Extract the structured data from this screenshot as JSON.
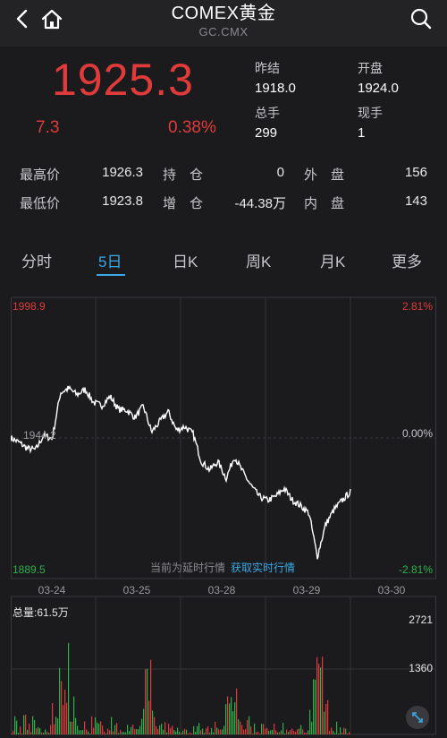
{
  "nav": {
    "title": "COMEX黄金",
    "subtitle": "GC.CMX"
  },
  "quote": {
    "price": "1925.3",
    "change": "7.3",
    "change_pct": "0.38%",
    "prev_close_label": "昨结",
    "prev_close": "1918.0",
    "open_label": "开盘",
    "open": "1924.0",
    "volume_label": "总手",
    "volume": "299",
    "current_volume_label": "现手",
    "current_volume": "1"
  },
  "stats": {
    "high_label": "最高价",
    "high": "1926.3",
    "low_label": "最低价",
    "low": "1923.8",
    "oi_label": "持　仓",
    "oi": "0",
    "oi_change_label": "增　仓",
    "oi_change": "-44.38万",
    "outer_label": "外　盘",
    "outer": "156",
    "inner_label": "内　盘",
    "inner": "143"
  },
  "tabs": [
    "分时",
    "5日",
    "日K",
    "周K",
    "月K",
    "更多"
  ],
  "active_tab": 1,
  "colors": {
    "up": "#e03b3b",
    "down": "#2fb14a",
    "accent": "#3aa8e6",
    "line": "#ffffff"
  },
  "chart_labels": {
    "max_price": "1998.9",
    "min_price": "1889.5",
    "max_pct": "2.81%",
    "zero_pct": "0.00%",
    "min_pct": "-2.81%",
    "notice": "当前为延时行情",
    "realtime_link": "获取实时行情",
    "volume_label": "总量:61.5万",
    "vol_max": "2721",
    "vol_mid": "1360",
    "center_price": "1944.2"
  },
  "chart_data": {
    "type": "line",
    "x": [
      "03-24",
      "03-25",
      "03-28",
      "03-29",
      "03-30"
    ],
    "ylim": [
      1889.5,
      1998.9
    ],
    "series": [
      {
        "values": [
          1944.2,
          1942.5,
          1940.1,
          1939.6,
          1945.3,
          1943.8,
          1961.8,
          1963.5,
          1961.0,
          1963.1,
          1958.0,
          1956.8,
          1960.4,
          1955.3,
          1955.0,
          1952.2,
          1956.6,
          1946.5,
          1950.6,
          1954.5,
          1947.2,
          1948.6,
          1945.9,
          1935.1,
          1931.8,
          1935.0,
          1928.5,
          1937.0,
          1931.0,
          1925.7,
          1921.4,
          1919.9,
          1921.5,
          1924.6,
          1920.0,
          1917.8,
          1915.0,
          1898.0,
          1910.5,
          1916.2,
          1919.9,
          1923.2
        ]
      }
    ]
  },
  "volume_data": {
    "max": 2721,
    "mid": 1360
  }
}
